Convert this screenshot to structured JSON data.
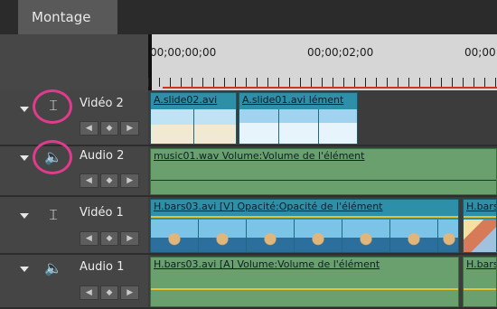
{
  "panel": {
    "tab_label": "Montage"
  },
  "ruler": {
    "timecodes": [
      "00;00;00;00",
      "00;00;02;00",
      "00;00"
    ]
  },
  "tracks": [
    {
      "id": "video2",
      "name": "Vidéo 2",
      "type": "video",
      "highlighted": true,
      "clips": [
        {
          "label": "A.slide02.avi"
        },
        {
          "label": "A.slide01.avi  lément"
        }
      ]
    },
    {
      "id": "audio2",
      "name": "Audio 2",
      "type": "audio",
      "highlighted": true,
      "clips": [
        {
          "label": "music01.wav  Volume:Volume de l'élément"
        }
      ]
    },
    {
      "id": "video1",
      "name": "Vidéo 1",
      "type": "video",
      "highlighted": false,
      "clips": [
        {
          "label": "H.bars03.avi [V]  Opacité:Opacité de l'élément"
        },
        {
          "label": "H.bars"
        }
      ]
    },
    {
      "id": "audio1",
      "name": "Audio 1",
      "type": "audio",
      "highlighted": false,
      "clips": [
        {
          "label": "H.bars03.avi [A]  Volume:Volume de l'élément"
        },
        {
          "label": "H.bars"
        }
      ]
    }
  ],
  "keyframe_controls": [
    "◀",
    "◆",
    "▶"
  ],
  "colors": {
    "highlight_ring": "#e23b8e",
    "video_clip": "#2e8fa9",
    "audio_clip": "#6aa06e",
    "playhead_line": "#d0331f"
  }
}
